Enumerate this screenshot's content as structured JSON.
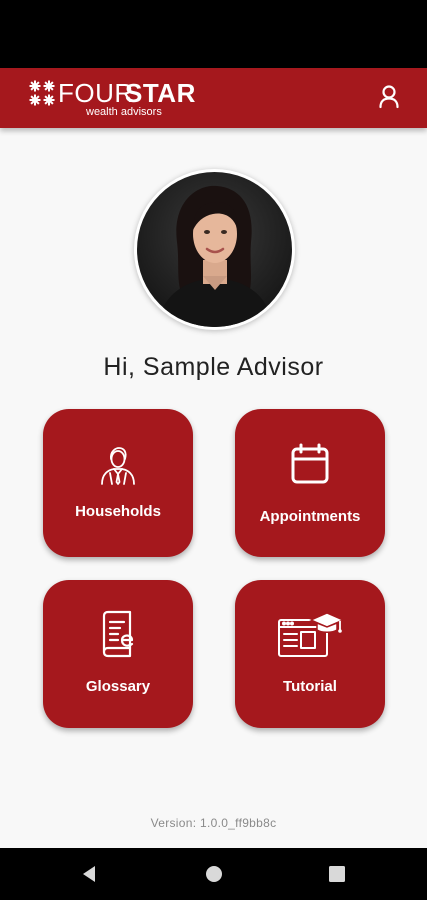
{
  "app": {
    "brand": {
      "part1": "FOUR",
      "part2": "STAR",
      "tagline": "wealth advisors"
    }
  },
  "icons": {
    "profile": "user-icon",
    "households": "person-in-suit-icon",
    "appointments": "calendar-icon",
    "glossary": "book-icon",
    "tutorial": "online-course-icon"
  },
  "colors": {
    "brand": "#a5181d",
    "background": "#f8f8f8"
  },
  "home": {
    "greeting": "Hi, Sample Advisor",
    "tiles": [
      {
        "label": "Households"
      },
      {
        "label": "Appointments"
      },
      {
        "label": "Glossary"
      },
      {
        "label": "Tutorial"
      }
    ],
    "version": "Version: 1.0.0_ff9bb8c"
  },
  "system_nav": {
    "back": "back-icon",
    "home": "home-icon",
    "recents": "recents-icon"
  }
}
